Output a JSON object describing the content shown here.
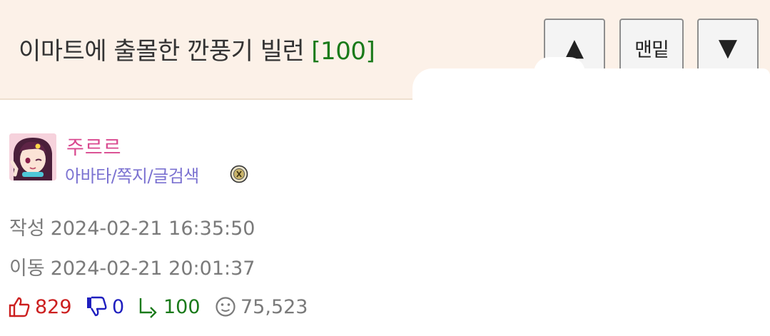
{
  "header": {
    "title": "이마트에 출몰한 깐풍기 빌런",
    "comment_count": "[100]",
    "buttons": {
      "up": "▲",
      "bottom": "맨밑",
      "down": "▼"
    }
  },
  "author": {
    "name": "주르르",
    "links": [
      "아바타",
      "쪽지",
      "글검색"
    ],
    "separator": "/",
    "avatar_icon": "anime-girl-avatar",
    "badge_icon": "level-badge-icon"
  },
  "meta": {
    "created_label": "작성",
    "created_value": "2024-02-21 16:35:50",
    "moved_label": "이동",
    "moved_value": "2024-02-21 20:01:37"
  },
  "stats": {
    "upvotes": "829",
    "downvotes": "0",
    "replies": "100",
    "views": "75,523"
  },
  "colors": {
    "header_bg": "#fcf1e8",
    "title": "#333333",
    "comment_count": "#1a7a1a",
    "author_name": "#d9488f",
    "author_links": "#7b72d1",
    "upvote": "#cc1f1f",
    "downvote": "#1f1fbf",
    "reply": "#1a7a1a",
    "meta_text": "#7a7a7a"
  }
}
